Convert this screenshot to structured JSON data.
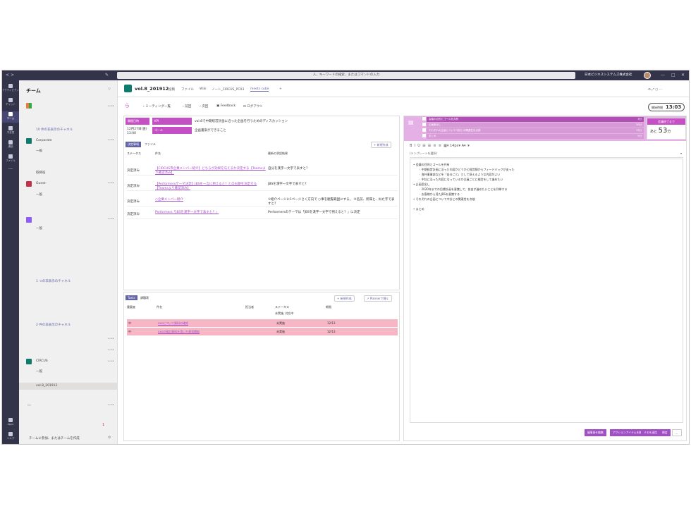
{
  "titlebar": {
    "search_placeholder": "人、キーワードの検索、またはコマンドの入力",
    "org": "日本ビジネスシステムズ株式会社"
  },
  "rail": [
    "アクティビティ",
    "チャット",
    "チーム",
    "予定表",
    "通話",
    "ファイル",
    "Apps",
    "ヘルプ"
  ],
  "teams": {
    "header": "チーム",
    "items": [
      "10 件の非表示のチャネル",
      "Corporate",
      "一般",
      "取締役",
      "Guest-",
      "一般",
      "一般",
      "1 つの非表示のチャネル",
      "2 件の非表示のチャネル",
      "CIRCUS",
      "一般",
      "vol.8_201912"
    ],
    "footer": "チームに参加、またはチームを作成",
    "badge": "1"
  },
  "tabs": {
    "team": "vol.8_201912",
    "items": [
      "投稿",
      "ファイル",
      "Wiki",
      "ノート_CIRCUS_PC03",
      "meets cube"
    ]
  },
  "toolbar": {
    "meetings": "ミーティング一覧",
    "prev": "前回",
    "next": "次回",
    "feedback": "Feedback",
    "logout": "ログアウト",
    "timer_label": "開始時間",
    "timer": "13:03"
  },
  "meeting": {
    "date_label": "開催日時",
    "date": "12月27日(金)\n13:00",
    "kpi_label": "KPI",
    "kpi": "vol.8で中期経営計画に沿った企画を行うためのディスカッション",
    "goal_label": "ゴール",
    "goal": "企画書案ができること"
  },
  "decisions": {
    "tabs": [
      "決定事項",
      "ファイル"
    ],
    "add": "新規作成",
    "headers": [
      "ステータス",
      "件名",
      "最新の承認結果"
    ],
    "rows": [
      {
        "status": "決定済み",
        "title": "【CIRCUS市企業メンバー紹介】どちらが効果を与えるか決定する【Teamsより確認済み】",
        "result": "自分を漢字一文字で表すと？"
      },
      {
        "status": "決定済み",
        "title": "【Performersゲーマ決定】JBSを一言に例えると？とのお題を決定する【Teamsより確認済み】",
        "result": "JBSを漢字一文字で表すと？"
      },
      {
        "status": "決定済み",
        "title": "○企業メンバー紹介",
        "result": "①紹介ページに1ページさく方向で ○事を観覧範囲にする。 ②名前、所属と、似た字で表すと？"
      },
      {
        "status": "決定済み",
        "title": "Performers「JBSを漢字一文字で表すと？」",
        "result": "Performersのテーマは「JBSを漢字一文字で例えると？」に決定"
      }
    ]
  },
  "tasks": {
    "tabs": [
      "Tasks",
      "課題表"
    ],
    "add": "新規作成",
    "planner": "Plannerで開く",
    "headers": [
      "重要度",
      "件名",
      "担当者",
      "ステータス",
      "期限"
    ],
    "filter": "未実施, 対応中",
    "rows": [
      {
        "pri": "中",
        "title": "xxxについて資料の確認",
        "status": "未実施",
        "due": "12/13"
      },
      {
        "pri": "中",
        "title": "xxxの検討資料を用いた意見聴取",
        "status": "未実施",
        "due": "12/13"
      }
    ]
  },
  "agenda": {
    "items": [
      {
        "t": "会議の目的とゴールを共有",
        "time": "3分"
      },
      {
        "t": "企画案出し",
        "time": "30分"
      },
      {
        "t": "それぞれの企画について今回との関連性を点検",
        "time": "15分"
      },
      {
        "t": "まとめ",
        "time": "5分"
      }
    ],
    "button": "会議終了まで",
    "remain_prefix": "あと",
    "remain": "53",
    "remain_unit": "分"
  },
  "editor": {
    "template": "(テンプレートを選択)",
    "fontsize": "14px",
    "lines": [
      "会議の目的とゴールを共有",
      "中期経営計画に沿った内容かどうかと経営陣からフィードバックがあった",
      "海外事業部などを「自分ごと」として捉えるような内容がよい",
      "中計に沿った内容になっているか全員ごとに検討をして進めたい",
      "企画案出し",
      "2020年までの目標計画を意識して、各自が進めたいことを列挙する",
      "お客様から見たJBSを意識する",
      "それぞれの企画について中計との関連性を点検",
      "まとめ"
    ],
    "buttons": [
      "議事録を編集",
      "アクションアイテムを開く",
      "メモを送信",
      "閉会"
    ]
  },
  "colors": {
    "accent": "#6264a7",
    "pink": "#c54fc5",
    "task": "#f6b6c5"
  }
}
